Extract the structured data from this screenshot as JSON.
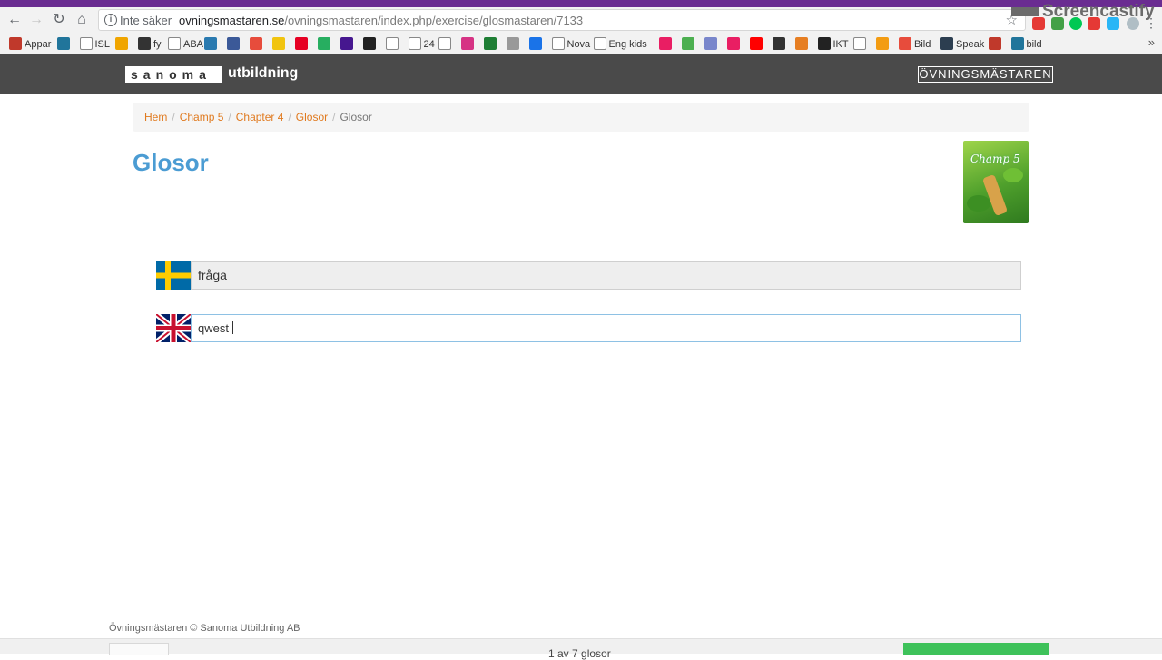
{
  "browser": {
    "security_label": "Inte säker",
    "url_domain": "ovningsmastaren.se",
    "url_path": "/ovningsmastaren/index.php/exercise/glosmastaren/7133",
    "screencastify_label": "Screencastify"
  },
  "bookmarks": [
    {
      "label": "Appar",
      "color": "#c0392b"
    },
    {
      "label": "",
      "color": "#21759b"
    },
    {
      "label": "ISL",
      "color": "#ffffff"
    },
    {
      "label": "",
      "color": "#f0a500"
    },
    {
      "label": "fy",
      "color": "#333333"
    },
    {
      "label": "ABA",
      "color": "#ffffff"
    },
    {
      "label": "",
      "color": "#2a7ab0"
    },
    {
      "label": "",
      "color": "#3b5998"
    },
    {
      "label": "",
      "color": "#e74c3c"
    },
    {
      "label": "",
      "color": "#f1c40f"
    },
    {
      "label": "",
      "color": "#e60023"
    },
    {
      "label": "",
      "color": "#27ae60"
    },
    {
      "label": "",
      "color": "#46178f"
    },
    {
      "label": "",
      "color": "#222222"
    },
    {
      "label": "",
      "color": "#ffffff"
    },
    {
      "label": "24",
      "color": "#ffffff"
    },
    {
      "label": "",
      "color": "#ffffff"
    },
    {
      "label": "",
      "color": "#d63384"
    },
    {
      "label": "",
      "color": "#1e7e34"
    },
    {
      "label": "",
      "color": "#999999"
    },
    {
      "label": "",
      "color": "#1a73e8"
    },
    {
      "label": "Nova",
      "color": "#ffffff"
    },
    {
      "label": "Eng kids",
      "color": "#ffffff"
    },
    {
      "label": "",
      "color": "#e91e63"
    },
    {
      "label": "",
      "color": "#4caf50"
    },
    {
      "label": "",
      "color": "#7986cb"
    },
    {
      "label": "",
      "color": "#e91e63"
    },
    {
      "label": "",
      "color": "#ff0000"
    },
    {
      "label": "",
      "color": "#333333"
    },
    {
      "label": "",
      "color": "#e67e22"
    },
    {
      "label": "IKT",
      "color": "#222222"
    },
    {
      "label": "",
      "color": "#ffffff"
    },
    {
      "label": "",
      "color": "#f39c12"
    },
    {
      "label": "Bild",
      "color": "#e74c3c"
    },
    {
      "label": "Speak",
      "color": "#2c3e50"
    },
    {
      "label": "",
      "color": "#c0392b"
    },
    {
      "label": "bild",
      "color": "#21759b"
    }
  ],
  "header": {
    "sanoma_box": "sanoma",
    "sanoma_rest": "utbildning",
    "ovnings_logo": "ÖVNINGSMÄSTAREN"
  },
  "breadcrumb": {
    "items": [
      "Hem",
      "Champ 5",
      "Chapter 4",
      "Glosor"
    ],
    "active": "Glosor",
    "divider": "/"
  },
  "page": {
    "title": "Glosor",
    "book_cover_title": "Champ 5"
  },
  "exercise": {
    "swedish_word": "fråga",
    "english_answer": "qwest",
    "swedish_flag_colors": {
      "blue": "#006aa7",
      "yellow": "#fecc00"
    },
    "english_flag_colors": {
      "blue": "#012169",
      "red": "#c8102e",
      "white": "#ffffff"
    }
  },
  "footer": {
    "copyright": "Övningsmästaren © Sanoma Utbildning AB",
    "progress": "1 av 7 glosor"
  }
}
